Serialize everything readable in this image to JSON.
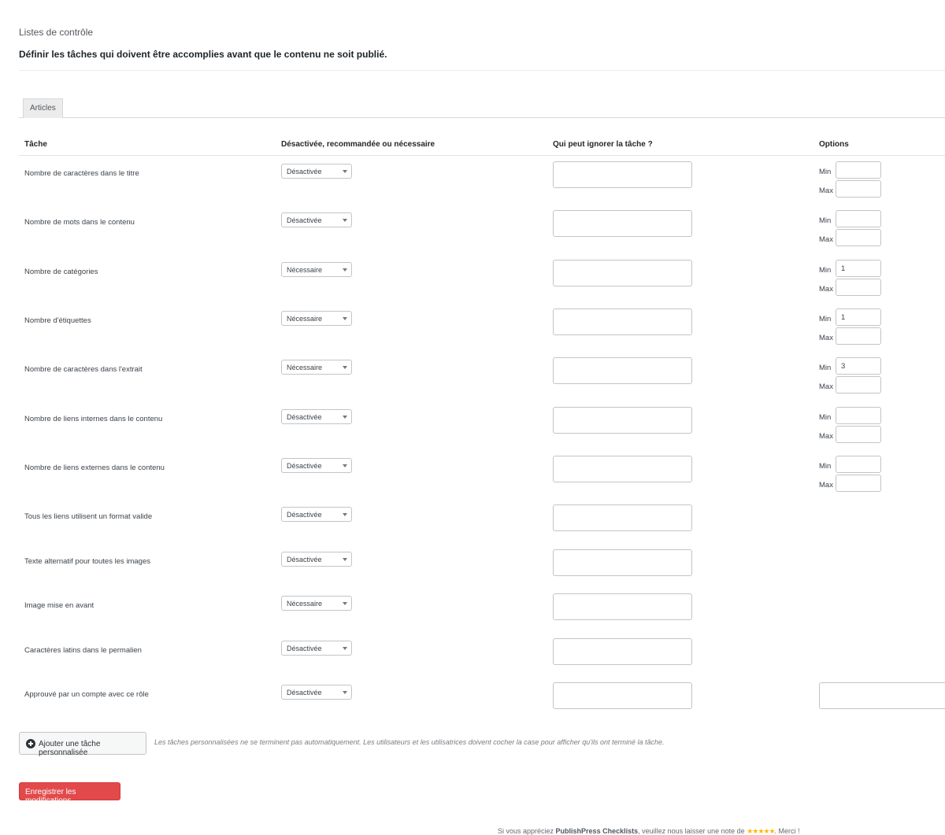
{
  "header": {
    "title": "Listes de contrôle",
    "description": "Définir les tâches qui doivent être accomplies avant que le contenu ne soit publié."
  },
  "tabs": [
    {
      "label": "Articles",
      "active": true
    }
  ],
  "columns": {
    "task": "Tâche",
    "status": "Désactivée, recommandée ou nécessaire",
    "who": "Qui peut ignorer la tâche ?",
    "options": "Options"
  },
  "option_labels": {
    "min": "Min",
    "max": "Max"
  },
  "tasks": [
    {
      "label": "Nombre de caractères dans le titre",
      "status": "Désactivée",
      "min": "",
      "max": ""
    },
    {
      "label": "Nombre de mots dans le contenu",
      "status": "Désactivée",
      "min": "",
      "max": ""
    },
    {
      "label": "Nombre de catégories",
      "status": "Nécessaire",
      "min": "1",
      "max": ""
    },
    {
      "label": "Nombre d'étiquettes",
      "status": "Nécessaire",
      "min": "1",
      "max": ""
    },
    {
      "label": "Nombre de caractères dans l'extrait",
      "status": "Nécessaire",
      "min": "3",
      "max": ""
    },
    {
      "label": "Nombre de liens internes dans le contenu",
      "status": "Désactivée",
      "min": "",
      "max": ""
    },
    {
      "label": "Nombre de liens externes dans le contenu",
      "status": "Désactivée",
      "min": "",
      "max": ""
    },
    {
      "label": "Tous les liens utilisent un format valide",
      "status": "Désactivée"
    },
    {
      "label": "Texte alternatif pour toutes les images",
      "status": "Désactivée"
    },
    {
      "label": "Image mise en avant",
      "status": "Nécessaire"
    },
    {
      "label": "Caractères latins dans le permalien",
      "status": "Désactivée"
    },
    {
      "label": "Approuvé par un compte avec ce rôle",
      "status": "Désactivée"
    }
  ],
  "add_button": {
    "label": "Ajouter une tâche personnalisée"
  },
  "custom_note": "Les tâches personnalisées ne se terminent pas automatiquement. Les utilisateurs et les utilisatrices doivent cocher la case pour afficher qu'ils ont terminé la tâche.",
  "save_button": {
    "label": "Enregistrer les modifications"
  },
  "footer": {
    "prefix": "Si vous appréciez ",
    "product": "PublishPress Checklists",
    "middle": ", veuillez nous laisser une note de ",
    "stars": "★★★★★",
    "suffix": ". Merci !"
  },
  "colors": {
    "accent_red": "#e2494b",
    "star_gold": "#ffb900"
  }
}
